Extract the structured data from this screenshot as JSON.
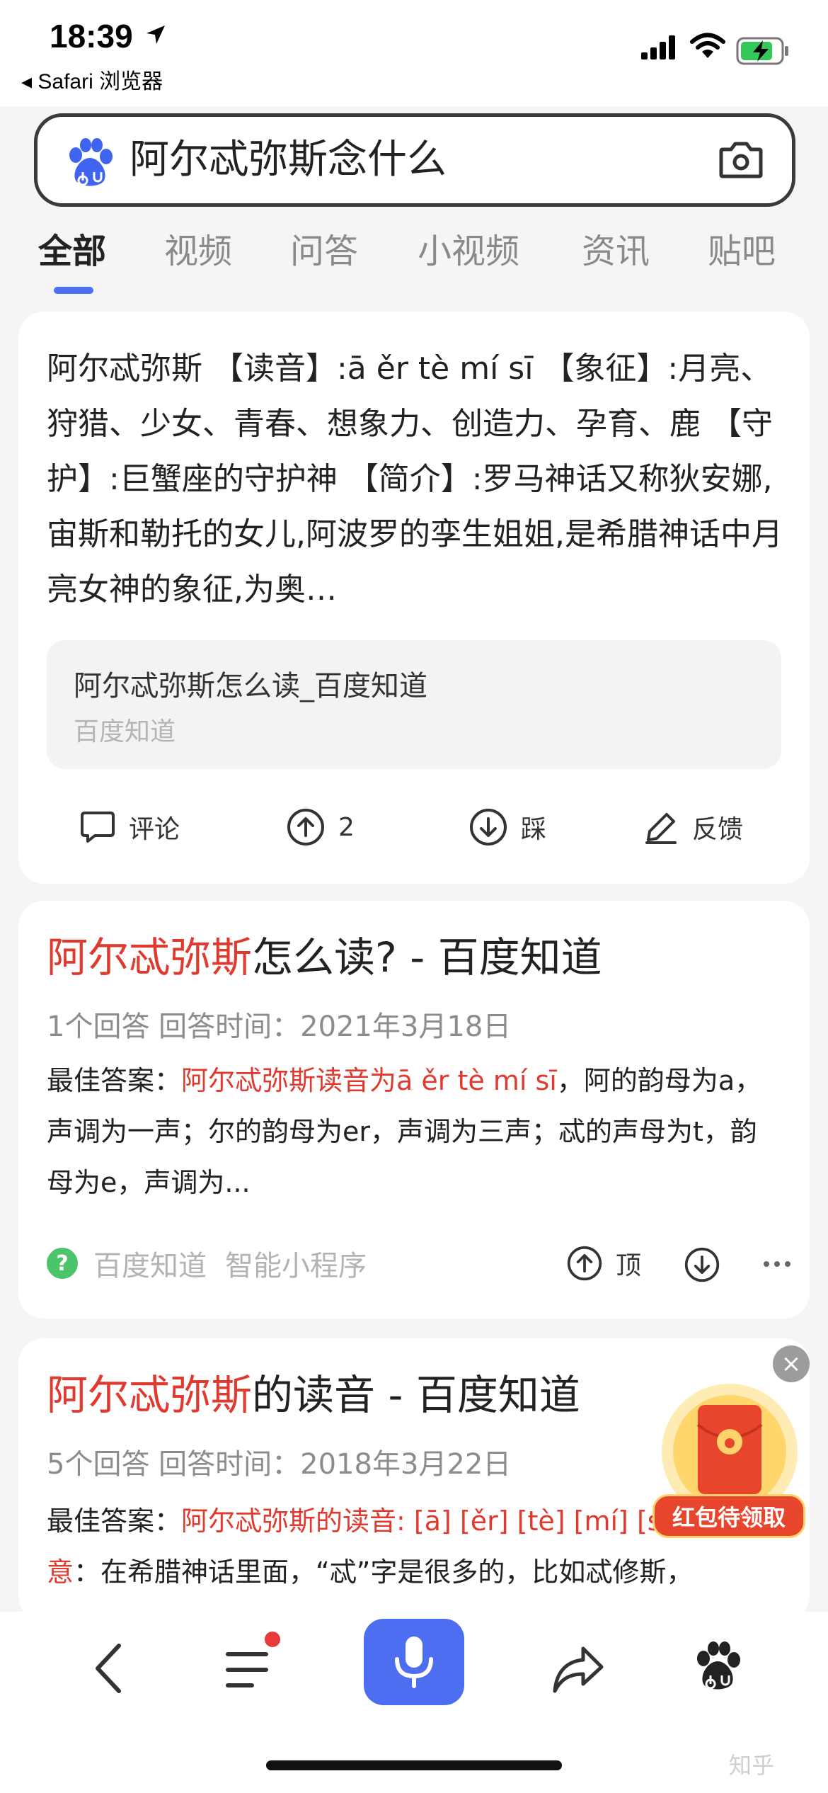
{
  "status_bar": {
    "time": "18:39",
    "back_app": "◂ Safari 浏览器"
  },
  "search": {
    "query": "阿尔忒弥斯念什么"
  },
  "tabs": [
    "全部",
    "视频",
    "问答",
    "小视频",
    "资讯",
    "贴吧"
  ],
  "card1": {
    "summary": "阿尔忒弥斯 【读音】:ā ěr tè mí sī 【象征】:月亮、狩猎、少女、青春、想象力、创造力、孕育、鹿 【守护】:巨蟹座的守护神 【简介】:罗马神话又称狄安娜,宙斯和勒托的女儿,阿波罗的孪生姐姐,是希腊神话中月亮女神的象征,为奥…",
    "source_title": "阿尔忒弥斯怎么读_百度知道",
    "source_name": "百度知道",
    "actions": {
      "comment": "评论",
      "upvote_count": "2",
      "downvote": "踩",
      "feedback": "反馈"
    }
  },
  "card2": {
    "title_hl": "阿尔忒弥斯",
    "title_rest": "怎么读? - 百度知道",
    "meta": "1个回答  回答时间：2021年3月18日",
    "ans_prefix": "最佳答案：",
    "ans_hl": "阿尔忒弥斯读音为ā ěr tè mí sī",
    "ans_rest": "，阿的韵母为a，声调为一声；尔的韵母为er，声调为三声；忒的声母为t，韵母为e，声调为...",
    "footer_source": "百度知道",
    "footer_mini": "智能小程序",
    "top_label": "顶"
  },
  "card3": {
    "title_hl": "阿尔忒弥斯",
    "title_rest": "的读音 - 百度知道",
    "meta": "5个回答  回答时间：2018年3月22日",
    "ans_prefix": "最佳答案：",
    "ans_hl": "阿尔忒弥斯的读音: [ā] [ěr] [tè] [mí] [sī]",
    "line2_hl": "意",
    "line2_rest": "：在希腊神话里面，“忒”字是很多的，比如忒修斯，"
  },
  "red_packet": {
    "label": "红包待领取",
    "close": "×"
  },
  "watermark": "知乎"
}
